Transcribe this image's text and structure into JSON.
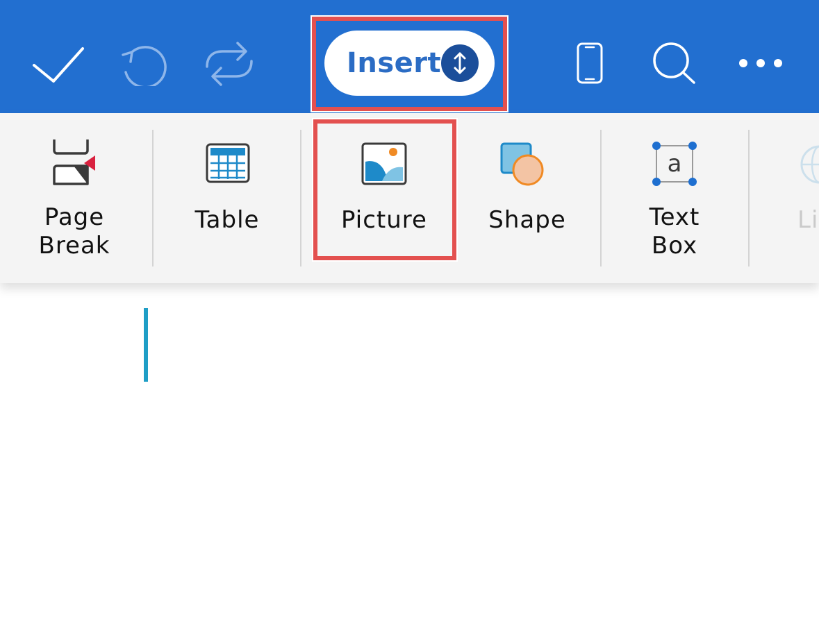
{
  "toolbar": {
    "confirm_icon": "checkmark-icon",
    "undo_icon": "undo-icon",
    "sync_icon": "sync-icon",
    "tab_selector": {
      "label": "Insert",
      "icon": "up-down-arrows-icon"
    },
    "view_icon": "phone-view-icon",
    "search_icon": "search-icon",
    "more_icon": "more-icon"
  },
  "ribbon": {
    "items": [
      {
        "label": "Page\nBreak",
        "icon": "page-break-icon"
      },
      {
        "label": "Table",
        "icon": "table-icon"
      },
      {
        "label": "Picture",
        "icon": "picture-icon"
      },
      {
        "label": "Shape",
        "icon": "shape-icon"
      },
      {
        "label": "Text\nBox",
        "icon": "text-box-icon"
      },
      {
        "label": "Li",
        "icon": "link-icon"
      }
    ]
  },
  "colors": {
    "toolbar_bg": "#226fd0",
    "ribbon_bg": "#f4f4f4",
    "highlight": "#e3504f",
    "cursor": "#1f9ec6"
  }
}
